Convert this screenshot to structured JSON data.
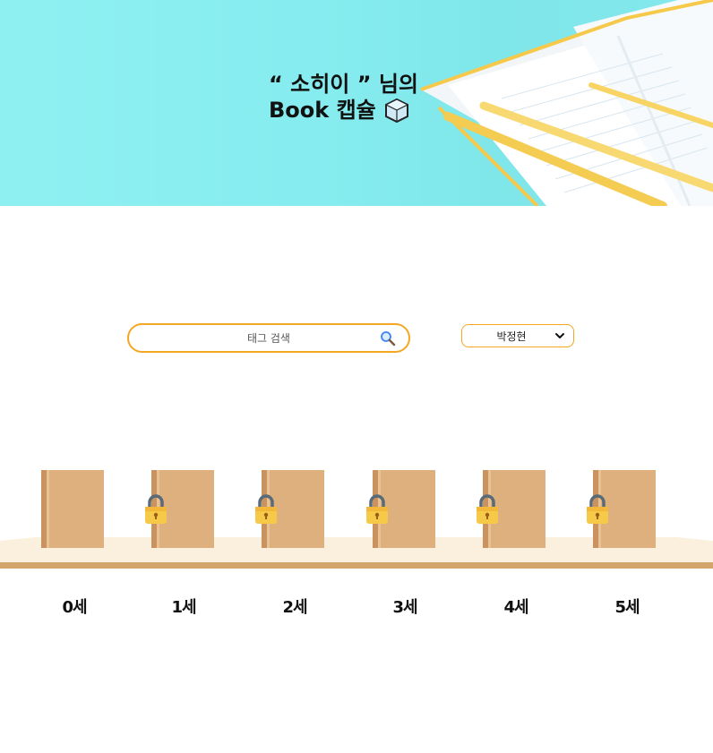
{
  "banner": {
    "title_line1": "“ 소히이 ” 님의",
    "title_line2": "Book 캡슐"
  },
  "search": {
    "placeholder": "태그 검색",
    "value": ""
  },
  "selector": {
    "selected": "박정현"
  },
  "books": [
    {
      "age_label": "0세",
      "locked": false
    },
    {
      "age_label": "1세",
      "locked": true
    },
    {
      "age_label": "2세",
      "locked": true
    },
    {
      "age_label": "3세",
      "locked": true
    },
    {
      "age_label": "4세",
      "locked": true
    },
    {
      "age_label": "5세",
      "locked": true
    }
  ],
  "colors": {
    "banner_bg": "#8ff0f1",
    "accent_orange": "#f5a623",
    "book_tan": "#deb07e",
    "lock_gold": "#f7c948"
  }
}
